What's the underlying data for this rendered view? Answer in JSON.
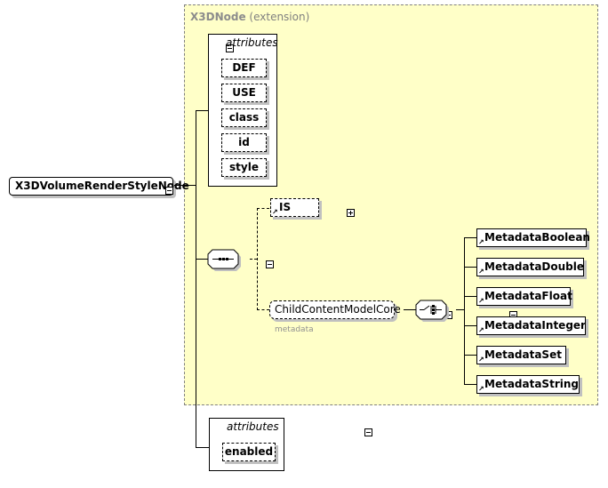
{
  "root": {
    "label": "X3DVolumeRenderStyleNode"
  },
  "extension": {
    "base": "X3DNode",
    "suffix": "(extension)"
  },
  "base_attributes": {
    "header": "attributes",
    "items": [
      "DEF",
      "USE",
      "class",
      "id",
      "style"
    ]
  },
  "sequence_children": {
    "is_element": "IS",
    "group": {
      "label": "ChildContentModelCore",
      "caption": "metadata"
    }
  },
  "choice_elements": [
    "MetadataBoolean",
    "MetadataDouble",
    "MetadataFloat",
    "MetadataInteger",
    "MetadataSet",
    "MetadataString"
  ],
  "own_attributes": {
    "header": "attributes",
    "items": [
      "enabled"
    ]
  },
  "colors": {
    "extension_bg": "#ffffc8",
    "shadow": "#c0c0c0"
  }
}
